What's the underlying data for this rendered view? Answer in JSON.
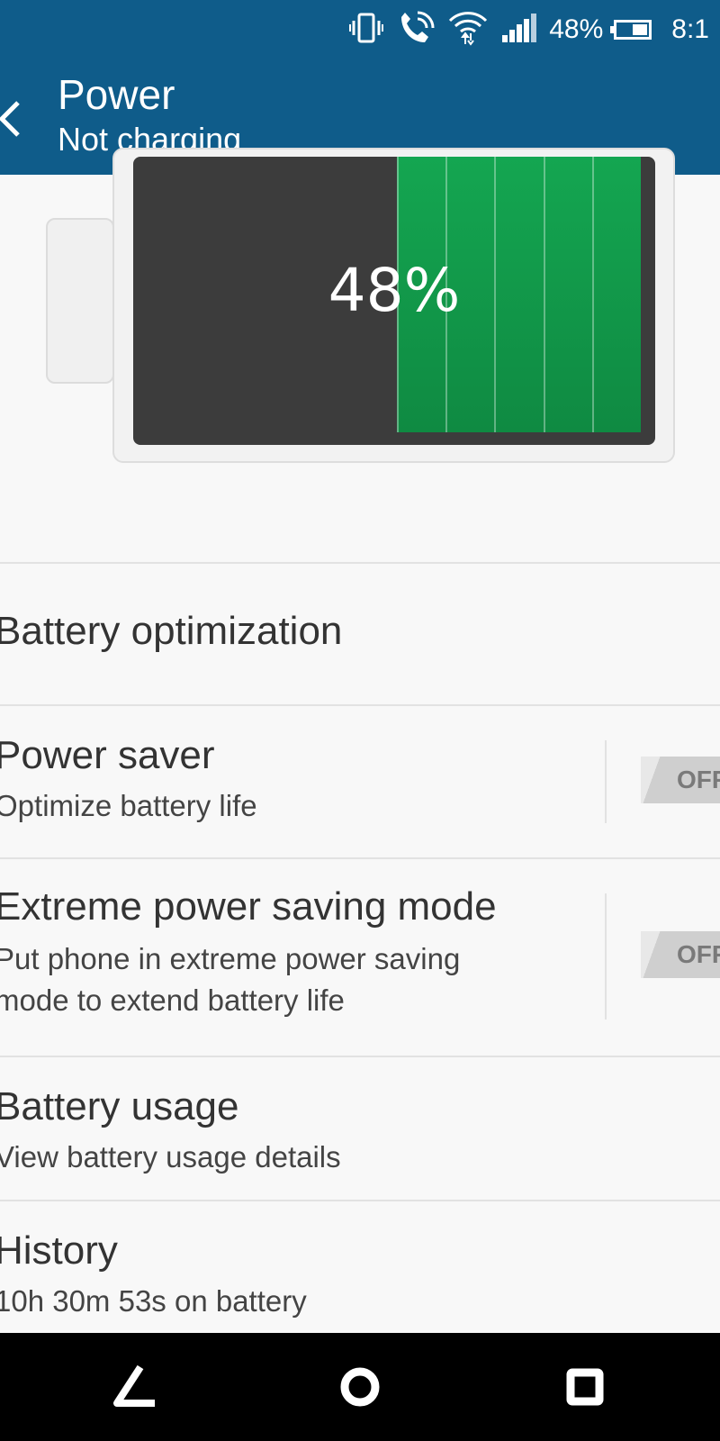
{
  "status_bar": {
    "battery_percent": "48%",
    "time": "8:1",
    "icons": [
      "vibrate-icon",
      "wifi-calling-icon",
      "wifi-icon",
      "signal-icon",
      "battery-icon"
    ]
  },
  "app_bar": {
    "title": "Power",
    "subtitle": "Not charging"
  },
  "battery_graphic": {
    "percent_label": "48%",
    "level": 0.48,
    "fill_color": "#14a651"
  },
  "list": {
    "battery_optimization": {
      "title": "Battery optimization"
    },
    "power_saver": {
      "title": "Power saver",
      "subtitle": "Optimize battery life",
      "toggle": "OFF"
    },
    "extreme_mode": {
      "title": "Extreme power saving mode",
      "subtitle_line1": "Put phone in extreme power saving",
      "subtitle_line2": "mode to extend battery life",
      "toggle": "OFF"
    },
    "battery_usage": {
      "title": "Battery usage",
      "subtitle": "View battery usage details"
    },
    "history": {
      "title": "History",
      "subtitle": "10h 30m 53s on battery"
    }
  },
  "nav_bar": {
    "icons": [
      "back-icon",
      "home-icon",
      "recents-icon"
    ]
  },
  "colors": {
    "accent": "#0f5c8a",
    "background": "#f8f8f8"
  }
}
